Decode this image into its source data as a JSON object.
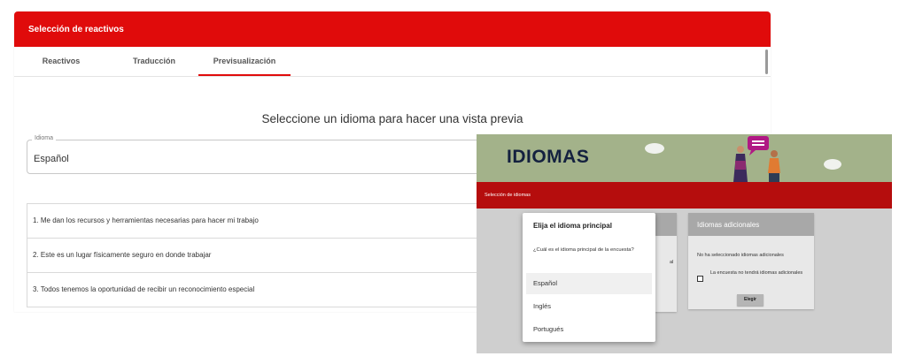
{
  "back": {
    "header_title": "Selección de reactivos",
    "tabs": [
      {
        "label": "Reactivos"
      },
      {
        "label": "Traducción"
      },
      {
        "label": "Previsualización"
      }
    ],
    "preview_title": "Seleccione un idioma para hacer una vista previa",
    "language_field": {
      "label": "Idioma",
      "value": "Español"
    },
    "questions": [
      "1. Me dan los recursos y herramientas necesarias para hacer mi trabajo",
      "2. Este es un lugar físicamente seguro en donde trabajar",
      "3. Todos tenemos la oportunidad de recibir un reconocimiento especial"
    ],
    "colors": {
      "accent": "#e00b0b"
    }
  },
  "front": {
    "banner_title": "IDIOMAS",
    "section_label": "Selección de idiomas",
    "additional_card": {
      "title": "Idiomas adicionales",
      "none_text": "No ha seleccionado idiomas adicionales",
      "checkbox_label": "La encuesta no tendrá idiomas adicionales",
      "button": "Elegir"
    },
    "left_card_fragment": "al",
    "dialog": {
      "title": "Elija el idioma principal",
      "question": "¿Cuál es el idioma principal de la encuesta?",
      "options": [
        "Español",
        "Inglés",
        "Portugués"
      ],
      "selected": "Español"
    },
    "colors": {
      "banner_bg": "#a3b28a",
      "bar": "#b50d0d"
    }
  }
}
